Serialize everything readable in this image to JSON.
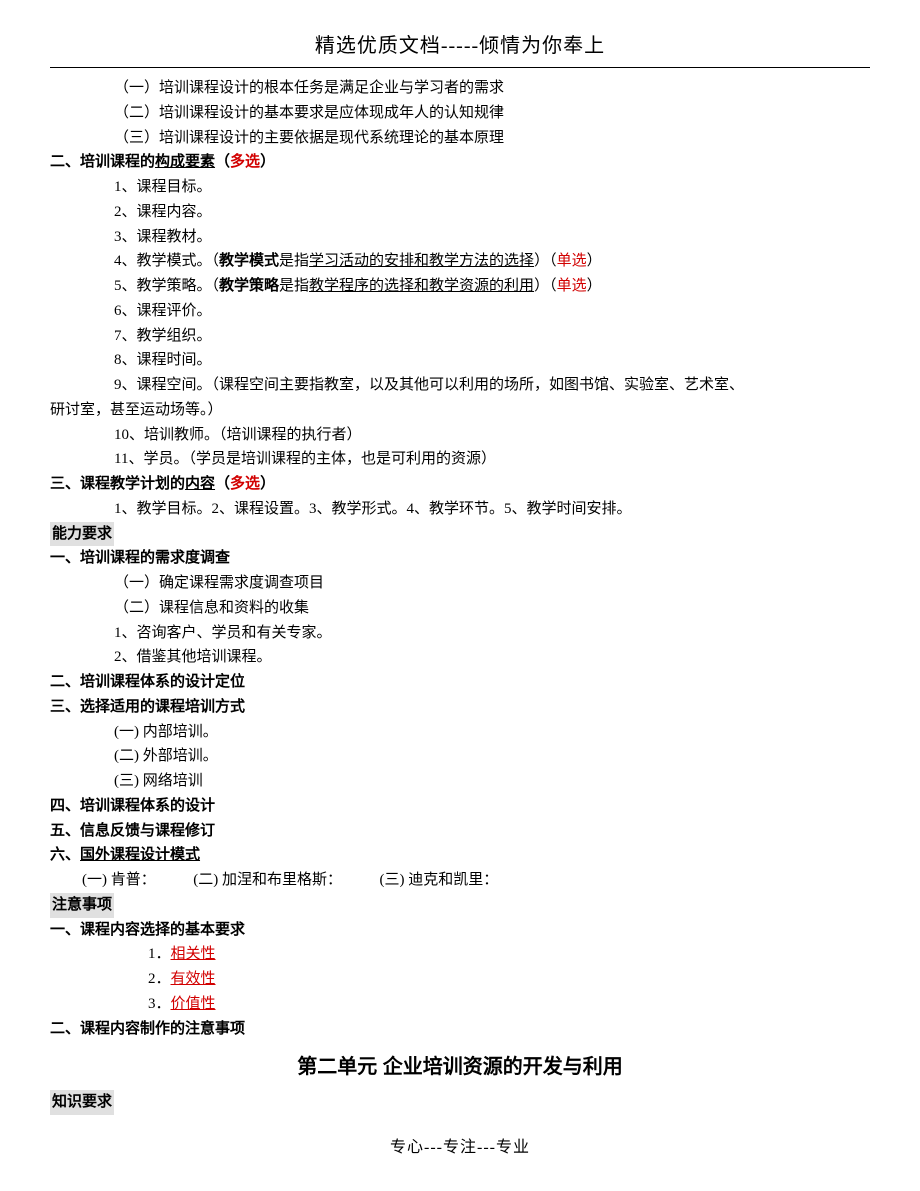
{
  "header": "精选优质文档-----倾情为你奉上",
  "footer": "专心---专注---专业",
  "l1": "（一）培训课程设计的根本任务是满足企业与学习者的需求",
  "l2": "（二）培训课程设计的基本要求是应体现成年人的认知规律",
  "l3": "（三）培训课程设计的主要依据是现代系统理论的基本原理",
  "s2": {
    "head1": "二、培训课程的",
    "head2": "构成要素",
    "head3": "（",
    "head4": "多选",
    "head5": "）"
  },
  "c1": "1、课程目标。",
  "c2": "2、课程内容。",
  "c3": "3、课程教材。",
  "c4": {
    "a": "4、教学模式。（",
    "b": "教学模式",
    "c": "是指",
    "d": "学习活动的安排和教学方法的选择",
    "e": "）（",
    "f": "单选",
    "g": "）"
  },
  "c5": {
    "a": "5、教学策略。（",
    "b": "教学策略",
    "c": "是指",
    "d": "教学程序的选择和教学资源的利用",
    "e": "）（",
    "f": "单选",
    "g": "）"
  },
  "c6": "6、课程评价。",
  "c7": "7、教学组织。",
  "c8": "8、课程时间。",
  "c9a": "9、课程空间。（课程空间主要指教室，以及其他可以利用的场所，如图书馆、实验室、艺术室、",
  "c9b": "研讨室，甚至运动场等。）",
  "c10": "10、培训教师。（培训课程的执行者）",
  "c11": "11、学员。（学员是培训课程的主体，也是可利用的资源）",
  "s3": {
    "a": "三、课程教学计划的",
    "b": "内容",
    "c": "（",
    "d": "多选",
    "e": "）"
  },
  "s3line": "1、教学目标。2、课程设置。3、教学形式。4、教学环节。5、教学时间安排。",
  "ability": "能力要求",
  "a1": "一、培训课程的需求度调查",
  "a1_1": "（一）确定课程需求度调查项目",
  "a1_2": "（二）课程信息和资料的收集",
  "a1_3": "1、咨询客户、学员和有关专家。",
  "a1_4": "2、借鉴其他培训课程。",
  "a2": "二、培训课程体系的设计定位",
  "a3": "三、选择适用的课程培训方式",
  "a3_1": "(一) 内部培训。",
  "a3_2": "(二) 外部培训。",
  "a3_3": "(三) 网络培训",
  "a4": "四、培训课程体系的设计",
  "a5": "五、信息反馈与课程修订",
  "a6": {
    "a": "六、",
    "b": "国外课程设计模式"
  },
  "a6line": "(一) 肯普：　　　(二) 加涅和布里格斯：　　　(三) 迪克和凯里：",
  "notice": "注意事项",
  "n1": "一、课程内容选择的基本要求",
  "n1_1a": "1．",
  "n1_1b": "相关性",
  "n1_2a": "2．",
  "n1_2b": "有效性",
  "n1_3a": "3．",
  "n1_3b": "价值性",
  "n2": "二、课程内容制作的注意事项",
  "unit2": "第二单元  企业培训资源的开发与利用",
  "knowledge": "知识要求"
}
